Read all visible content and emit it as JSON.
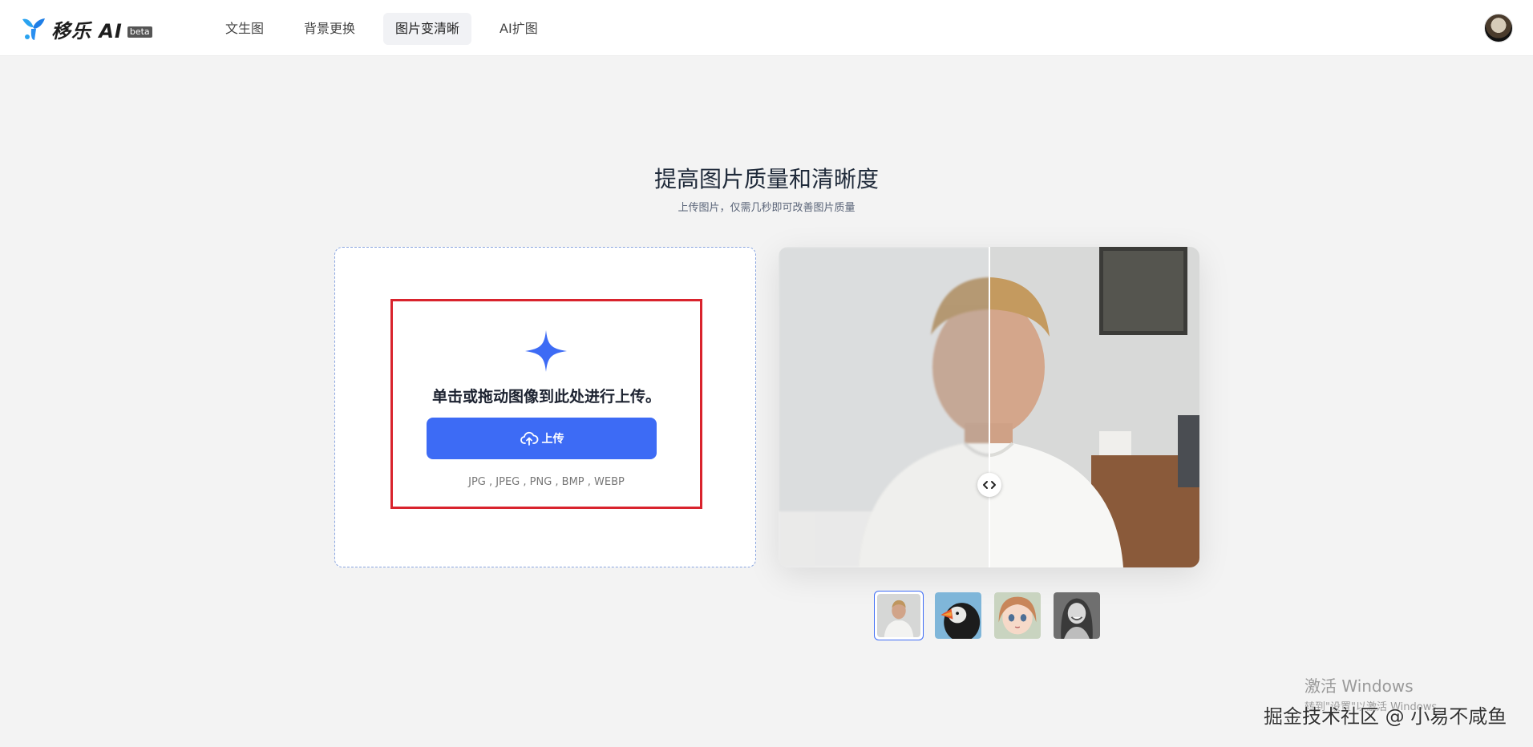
{
  "header": {
    "logo_text": "移乐 AI",
    "logo_badge": "beta",
    "nav": [
      {
        "label": "文生图"
      },
      {
        "label": "背景更换"
      },
      {
        "label": "图片变清晰",
        "active": true
      },
      {
        "label": "AI扩图"
      }
    ],
    "avatar_icon": "user-avatar"
  },
  "hero": {
    "title": "提高图片质量和清晰度",
    "subtitle": "上传图片，仅需几秒即可改善图片质量"
  },
  "upload": {
    "icon": "sparkle-plus-icon",
    "hint": "单击或拖动图像到此处进行上传。",
    "button_label": "上传",
    "button_icon": "cloud-upload-icon",
    "formats": "JPG , JPEG , PNG , BMP , WEBP",
    "accent_color": "#3d6bf5",
    "highlight_color": "#d9232d"
  },
  "compare": {
    "handle_icon": "left-right-arrows-icon",
    "split_fraction": 0.5
  },
  "samples": [
    {
      "name": "young-man-portrait",
      "selected": true
    },
    {
      "name": "puffin-bird"
    },
    {
      "name": "anime-girl"
    },
    {
      "name": "smiling-woman-bw"
    }
  ],
  "watermarks": {
    "windows_line1": "激活 Windows",
    "windows_line2": "转到\"设置\"以激活 Windows。",
    "site": "掘金技术社区 @ 小易不咸鱼"
  }
}
